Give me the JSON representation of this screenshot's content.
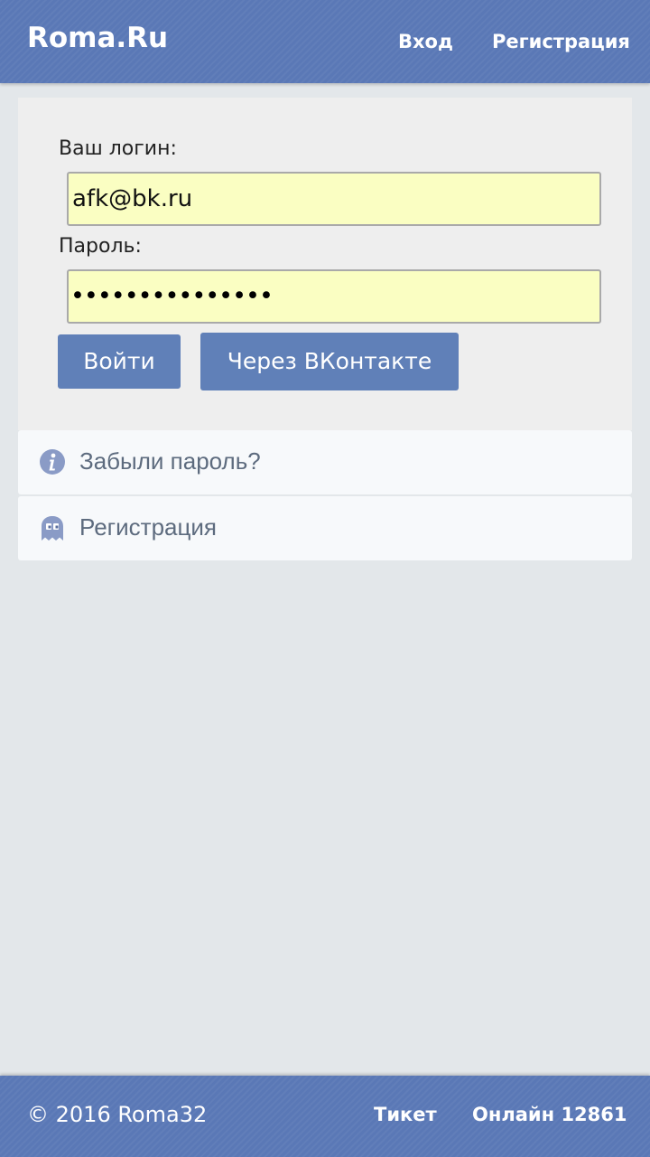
{
  "header": {
    "brand": "Roma.Ru",
    "nav": {
      "login": "Вход",
      "register": "Регистрация"
    }
  },
  "form": {
    "login_label": "Ваш логин:",
    "login_value": "afk@bk.ru",
    "password_label": "Пароль:",
    "password_mask": "•••••••••••••••",
    "submit_label": "Войти",
    "vk_label": "Через ВКонтакте"
  },
  "links": {
    "forgot": {
      "label": "Забыли пароль?",
      "icon": "info-icon"
    },
    "register": {
      "label": "Регистрация",
      "icon": "ghost-icon"
    }
  },
  "footer": {
    "copyright": "© 2016 Roma32",
    "ticket": "Тикет",
    "online": "Онлайн 12861"
  },
  "colors": {
    "bar": "#5a78b6",
    "button": "#6080b8",
    "input_bg": "#fafec2",
    "page_bg": "#e3e7ea"
  }
}
